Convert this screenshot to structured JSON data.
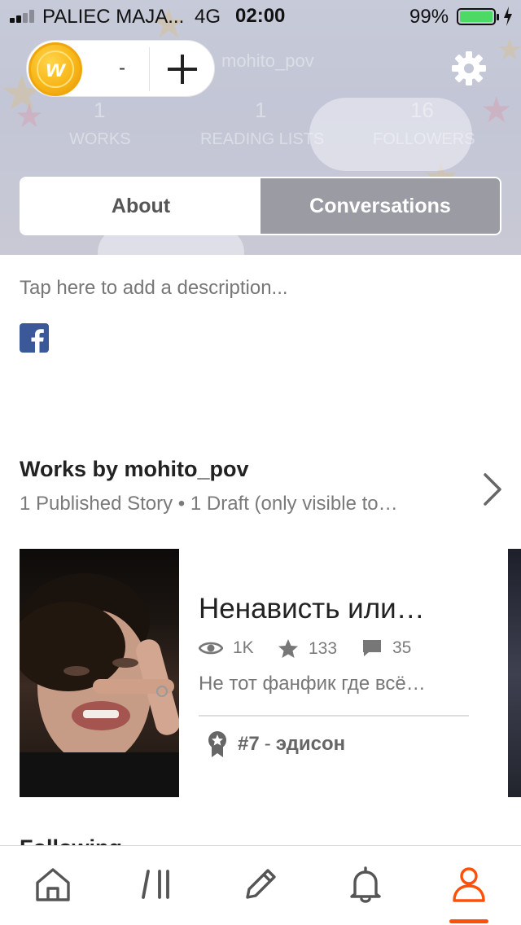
{
  "status_bar": {
    "carrier": "PALIEC MAJA...",
    "network": "4G",
    "time": "02:00",
    "battery_percent": "99%"
  },
  "header": {
    "coin_count": "-",
    "username_ghost": "mohito_pov",
    "stats": {
      "works": {
        "value": "1",
        "label": "WORKS"
      },
      "reading_lists": {
        "value": "1",
        "label": "READING LISTS"
      },
      "followers": {
        "value": "16",
        "label": "FOLLOWERS"
      }
    }
  },
  "tabs": {
    "about": "About",
    "conversations": "Conversations",
    "active": "conversations"
  },
  "about": {
    "description_placeholder": "Tap here to add a description..."
  },
  "works": {
    "title": "Works by mohito_pov",
    "subtitle": "1 Published Story • 1 Draft (only visible to…"
  },
  "story": {
    "title": "Ненависть или…",
    "reads": "1K",
    "votes": "133",
    "comments": "35",
    "description": "Не тот фанфик где всё…",
    "rank_number": "#7",
    "rank_separator": "-",
    "rank_tag": "эдисон"
  },
  "next_section_title": "Following",
  "bottom_nav": {
    "items": [
      "home-icon",
      "library-icon",
      "write-icon",
      "notifications-icon",
      "profile-icon"
    ],
    "active": "profile-icon",
    "active_color": "#ff500a"
  },
  "colors": {
    "accent": "#ff500a",
    "battery": "#4cd964",
    "coin": "#f7b415",
    "tab_active_bg": "#9a9ba3",
    "facebook": "#3b5998"
  }
}
